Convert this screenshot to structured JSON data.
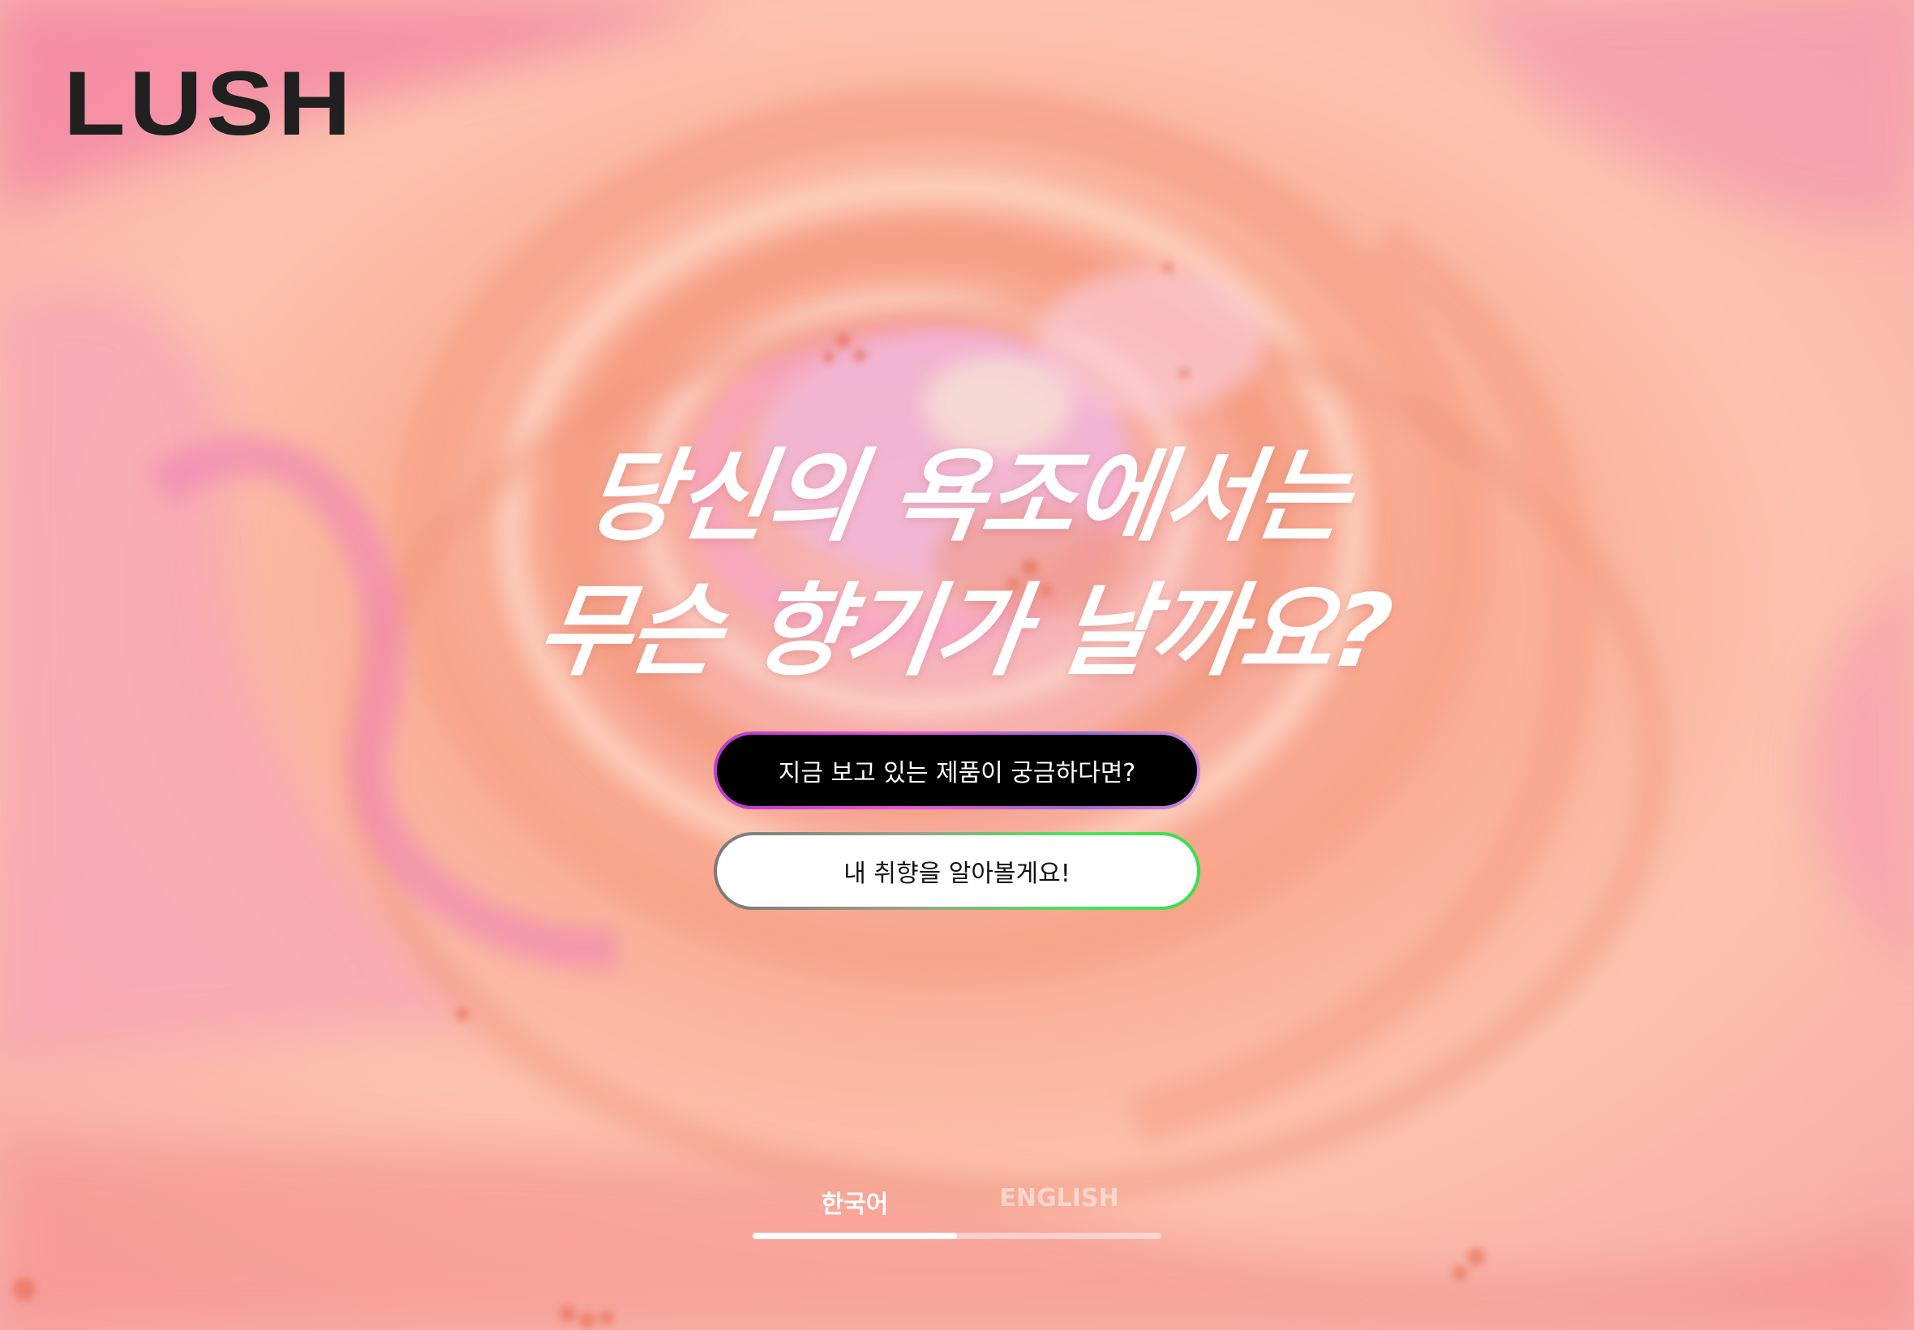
{
  "brand": {
    "logo_text": "LUSH"
  },
  "hero": {
    "headline_line1": "당신의 욕조에서는",
    "headline_line2": "무슨 향기가 날까요?"
  },
  "actions": {
    "primary_label": "지금 보고 있는 제품이 궁금하다면?",
    "secondary_label": "내 취향을 알아볼게요!"
  },
  "language_switcher": {
    "tabs": [
      {
        "label": "한국어",
        "active": true
      },
      {
        "label": "ENGLISH",
        "active": false
      }
    ],
    "active_fraction": 0.5
  },
  "colors": {
    "background": "#f9b8a3",
    "logo": "#202020",
    "primary_button_bg": "#000000",
    "primary_button_border": "#c04fd3",
    "secondary_button_bg": "#ffffff",
    "secondary_button_border": "#3ee04f"
  },
  "icons": {
    "background_image": "bath-bomb-swirl-image"
  }
}
